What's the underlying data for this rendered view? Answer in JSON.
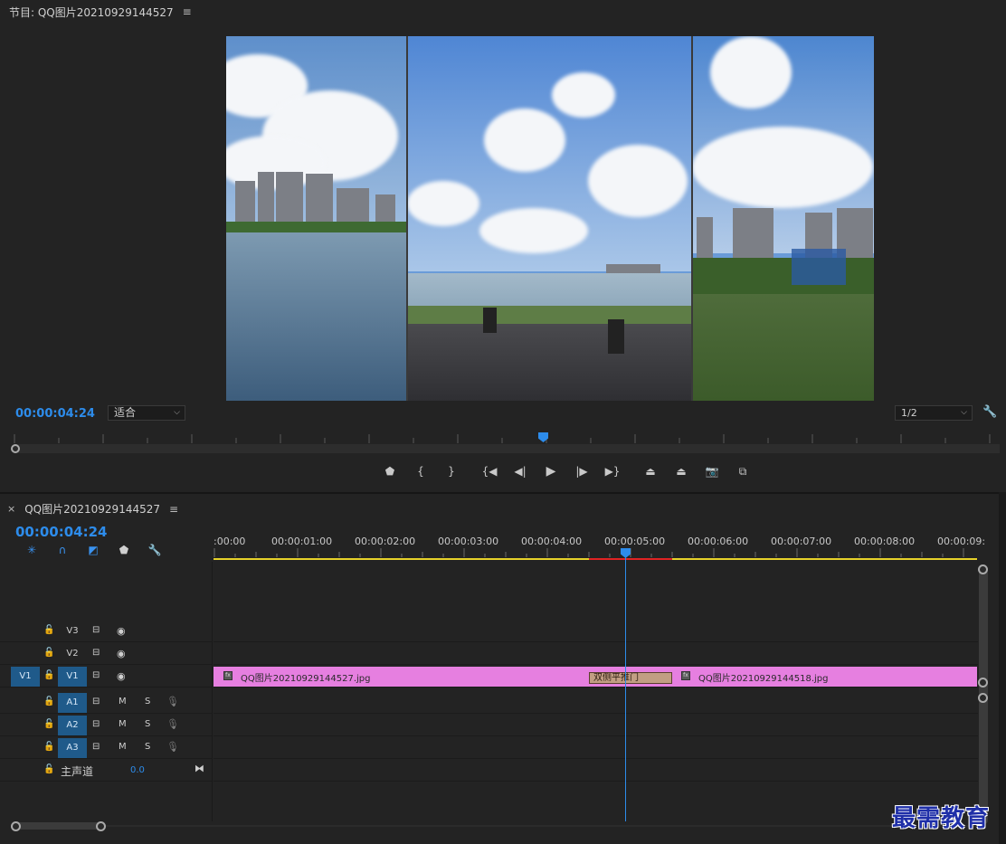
{
  "monitor": {
    "title": "节目: QQ图片20210929144527",
    "menu_icon": "hamburger-icon",
    "timecode": "00:00:04:24",
    "fit_label": "适合",
    "resolution_label": "1/2"
  },
  "transport_icons": [
    "marker-icon",
    "mark-in-icon",
    "mark-out-icon",
    "go-to-in-icon",
    "step-back-icon",
    "play-icon",
    "step-forward-icon",
    "go-to-out-icon",
    "lift-icon",
    "extract-icon",
    "export-frame-icon",
    "compare-icon"
  ],
  "timeline": {
    "tab_title": "QQ图片20210929144527",
    "timecode": "00:00:04:24",
    "ruler_labels": [
      ":00:00",
      "00:00:01:00",
      "00:00:02:00",
      "00:00:03:00",
      "00:00:04:00",
      "00:00:05:00",
      "00:00:06:00",
      "00:00:07:00",
      "00:00:08:00",
      "00:00:09:"
    ],
    "tracks": {
      "v3": "V3",
      "v2": "V2",
      "v1_source": "V1",
      "v1": "V1",
      "a1": "A1",
      "a2": "A2",
      "a3": "A3",
      "mute": "M",
      "solo": "S"
    },
    "master": {
      "label": "主声道",
      "value": "0.0"
    },
    "clips": {
      "clip1": "QQ图片20210929144527.jpg",
      "clip2": "QQ图片20210929144518.jpg",
      "transition": "双侧平推门"
    }
  },
  "watermark": "最需教育",
  "colors": {
    "accent_blue": "#2d8ceb",
    "clip_pink": "#e67fe0",
    "work_area_yellow": "#e6d22a",
    "render_red": "#e02323"
  }
}
